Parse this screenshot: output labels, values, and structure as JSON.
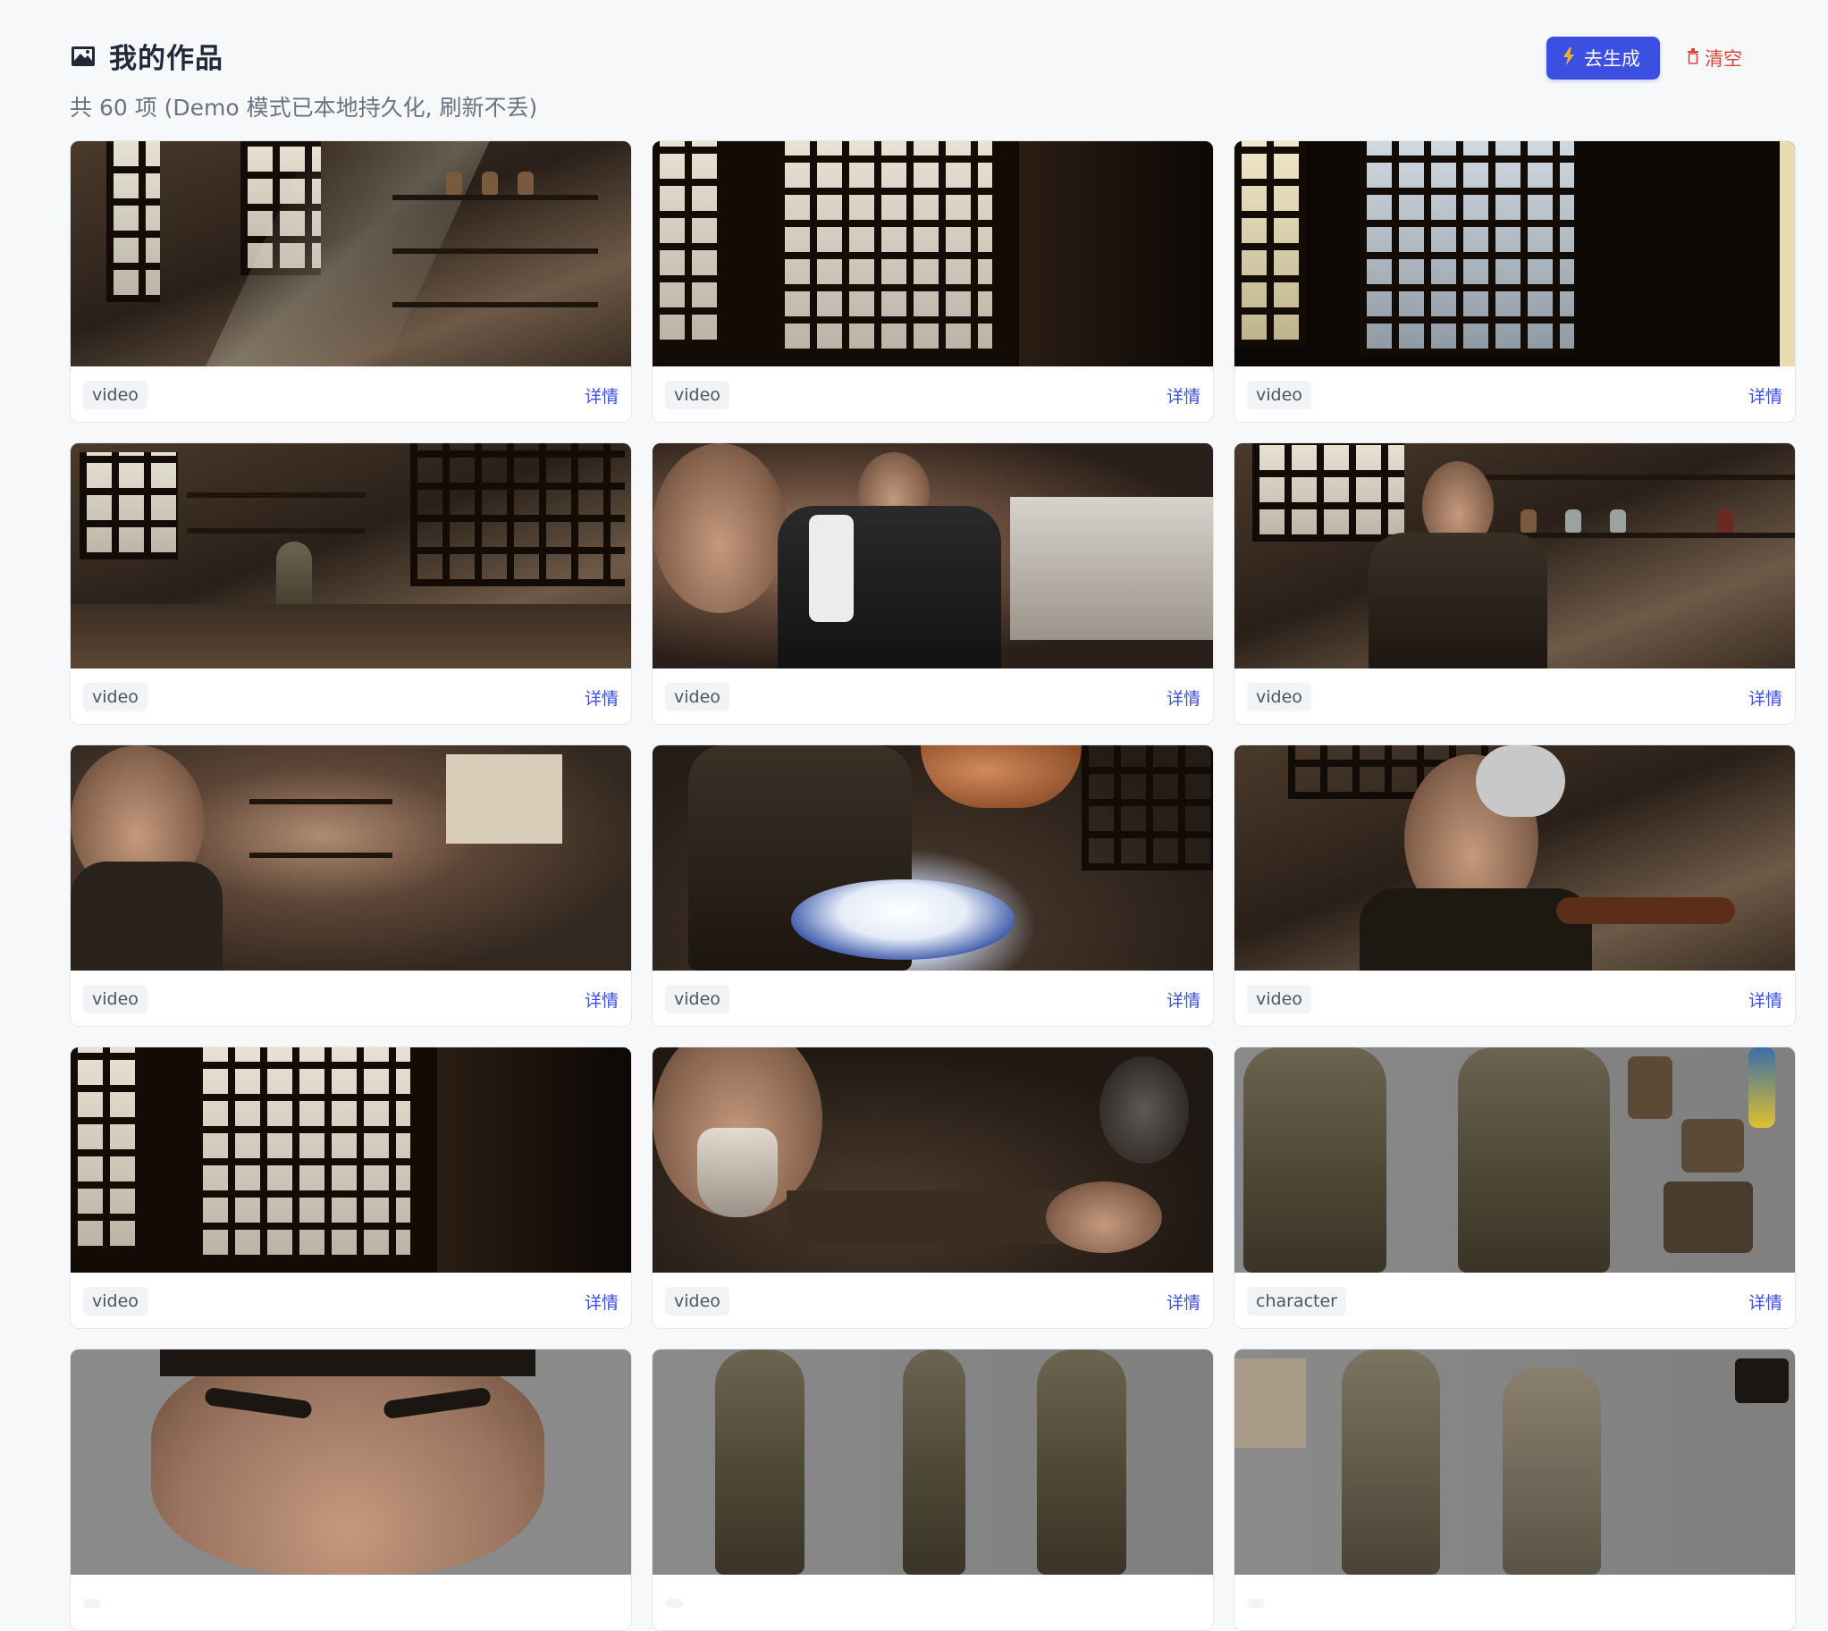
{
  "header": {
    "title": "我的作品",
    "subtitle": "共 60 项 (Demo 模式已本地持久化, 刷新不丢)",
    "generate_button": "去生成",
    "clear_button": "清空",
    "title_icon": "gallery-icon",
    "generate_icon": "lightning-icon",
    "clear_icon": "trash-icon"
  },
  "colors": {
    "accent": "#3b4fe0",
    "danger": "#e0443a",
    "background": "#f7f8fa"
  },
  "works": [
    {
      "type": "video",
      "detail": "详情"
    },
    {
      "type": "video",
      "detail": "详情"
    },
    {
      "type": "video",
      "detail": "详情"
    },
    {
      "type": "video",
      "detail": "详情"
    },
    {
      "type": "video",
      "detail": "详情"
    },
    {
      "type": "video",
      "detail": "详情"
    },
    {
      "type": "video",
      "detail": "详情"
    },
    {
      "type": "video",
      "detail": "详情"
    },
    {
      "type": "video",
      "detail": "详情"
    },
    {
      "type": "video",
      "detail": "详情"
    },
    {
      "type": "video",
      "detail": "详情"
    },
    {
      "type": "character",
      "detail": "详情"
    },
    {
      "type": "",
      "detail": ""
    },
    {
      "type": "",
      "detail": ""
    },
    {
      "type": "",
      "detail": ""
    }
  ]
}
